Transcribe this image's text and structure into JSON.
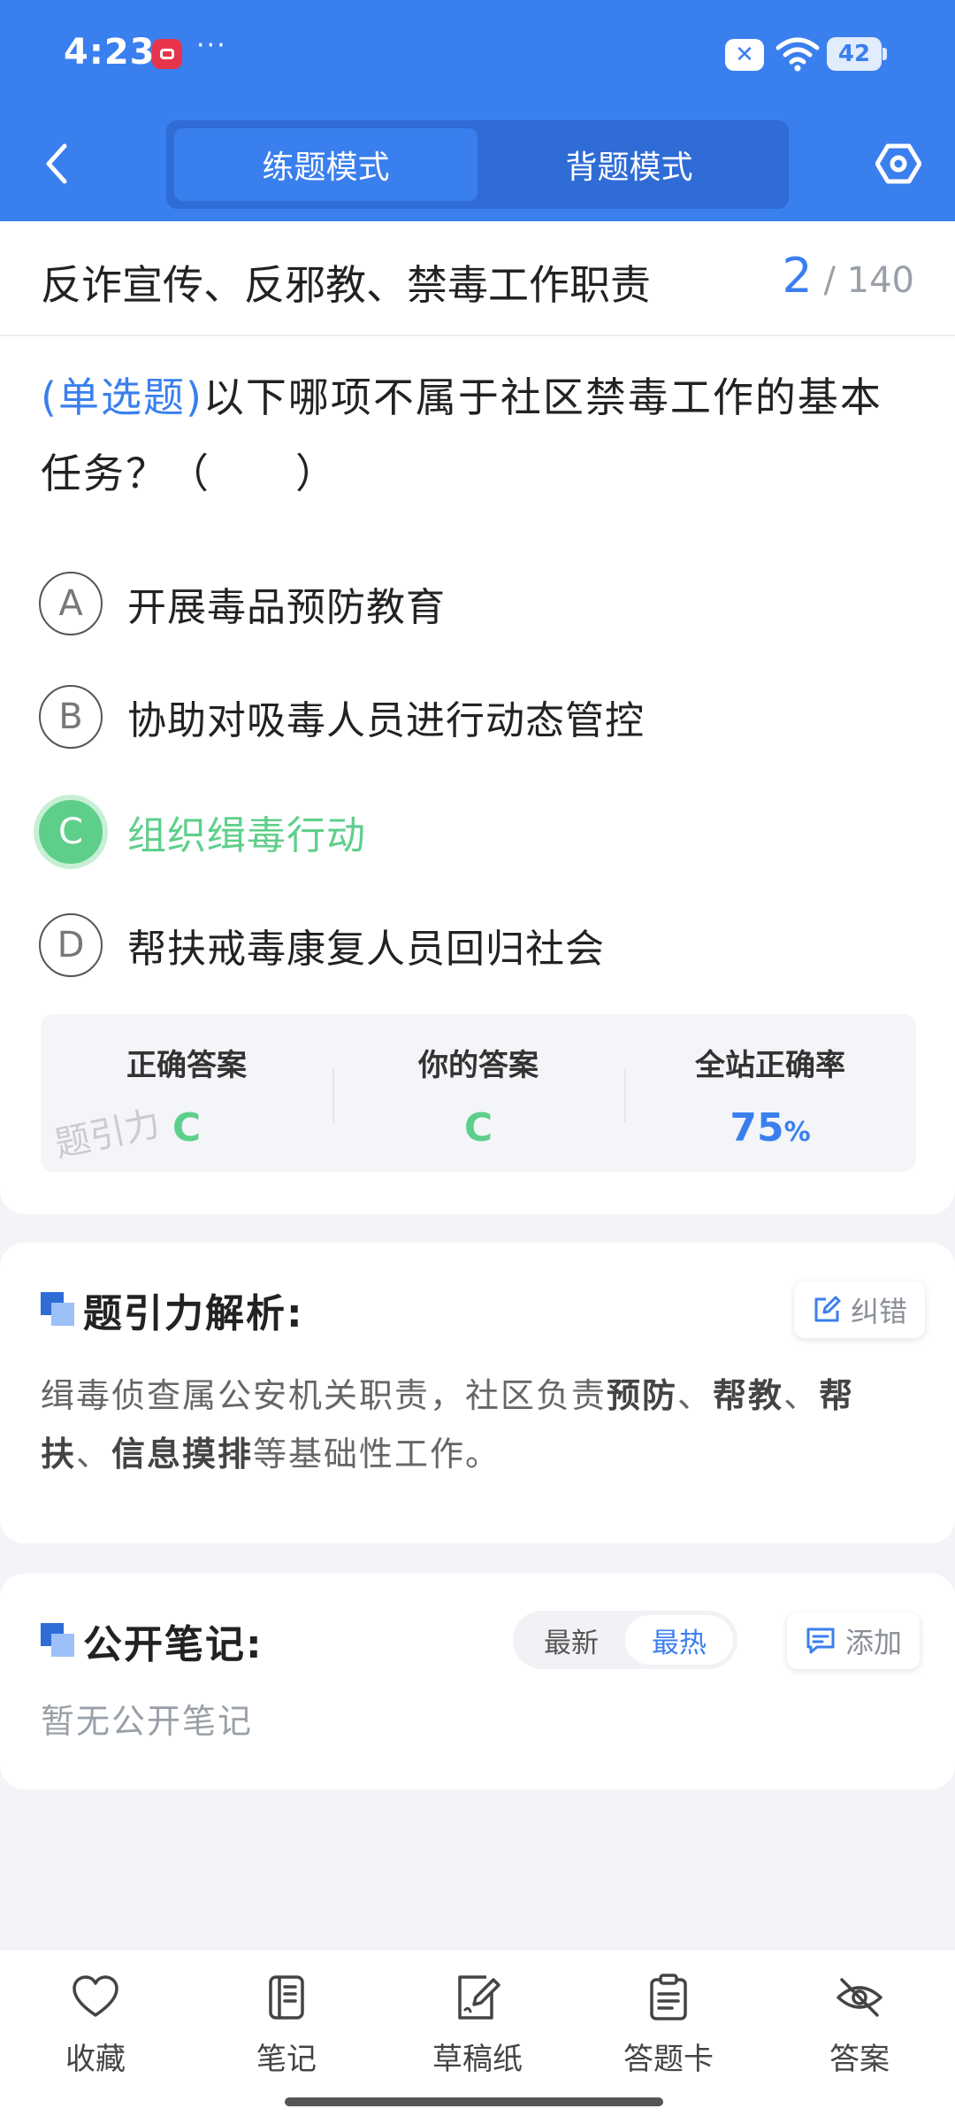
{
  "status_bar": {
    "time": "4:23",
    "dots": "···",
    "battery": "42"
  },
  "header": {
    "modes": [
      "练题模式",
      "背题模式"
    ],
    "active_mode": "练题模式"
  },
  "chapter": {
    "title": "反诈宣传、反邪教、禁毒工作职责",
    "current": "2",
    "separator": "/",
    "total": "140"
  },
  "question": {
    "type": "(单选题)",
    "text": "以下哪项不属于社区禁毒工作的基本任务？（　　）",
    "options": [
      {
        "letter": "A",
        "text": "开展毒品预防教育"
      },
      {
        "letter": "B",
        "text": "协助对吸毒人员进行动态管控"
      },
      {
        "letter": "C",
        "text": "组织缉毒行动"
      },
      {
        "letter": "D",
        "text": "帮扶戒毒康复人员回归社会"
      }
    ],
    "selected": "C"
  },
  "answer_summary": {
    "correct_label": "正确答案",
    "correct_value": "C",
    "yours_label": "你的答案",
    "yours_value": "C",
    "rate_label": "全站正确率",
    "rate_value": "75",
    "rate_unit": "%",
    "watermark": "题引力"
  },
  "analysis": {
    "title": "题引力解析:",
    "report_label": "纠错",
    "text_parts": [
      "缉毒侦查属公安机关职责，社区负责",
      "预防",
      "、",
      "帮教",
      "、",
      "帮扶",
      "、",
      "信息摸排",
      "等基础性工作。"
    ]
  },
  "notes": {
    "title": "公开笔记:",
    "sort_options": [
      "最新",
      "最热"
    ],
    "active_sort": "最热",
    "add_label": "添加",
    "empty_text": "暂无公开笔记"
  },
  "bottom_nav": [
    {
      "label": "收藏",
      "icon": "heart-icon"
    },
    {
      "label": "笔记",
      "icon": "notebook-icon"
    },
    {
      "label": "草稿纸",
      "icon": "draft-paper-icon"
    },
    {
      "label": "答题卡",
      "icon": "answer-sheet-icon"
    },
    {
      "label": "答案",
      "icon": "eye-off-icon"
    }
  ],
  "colors": {
    "brand_blue": "#3a7fee",
    "correct_green": "#5ecf8a"
  }
}
